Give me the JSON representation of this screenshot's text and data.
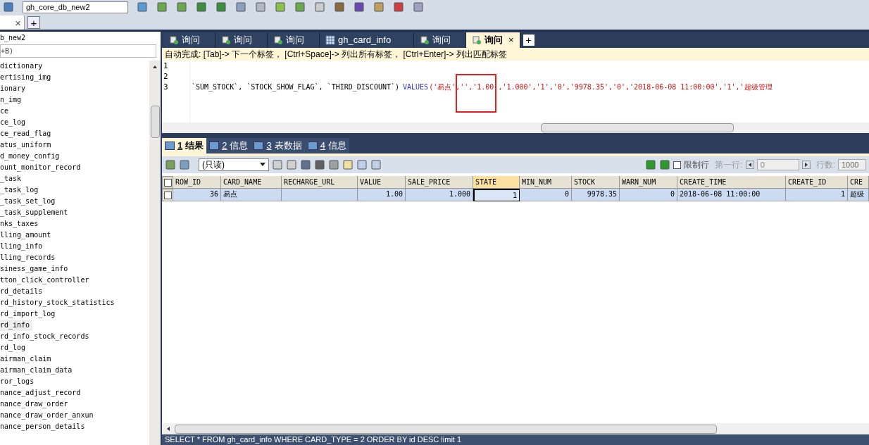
{
  "toolbar": {
    "database_select": "gh_core_db_new2"
  },
  "connection_tabs": {
    "close": "×",
    "add": "+"
  },
  "object_browser": {
    "database": "b_new2",
    "filter": "+B)",
    "tables": [
      {
        "name": "dictionary",
        "selected": false
      },
      {
        "name": "ertising_img",
        "selected": false
      },
      {
        "name": "ionary",
        "selected": false
      },
      {
        "name": "n_img",
        "selected": false
      },
      {
        "name": "ce",
        "selected": false
      },
      {
        "name": "ce_log",
        "selected": false
      },
      {
        "name": "ce_read_flag",
        "selected": false
      },
      {
        "name": "atus_uniform",
        "selected": false
      },
      {
        "name": "d_money_config",
        "selected": false
      },
      {
        "name": "ount_monitor_record",
        "selected": false
      },
      {
        "name": "_task",
        "selected": false
      },
      {
        "name": "_task_log",
        "selected": false
      },
      {
        "name": "_task_set_log",
        "selected": false
      },
      {
        "name": "_task_supplement",
        "selected": false
      },
      {
        "name": "nks_taxes",
        "selected": false
      },
      {
        "name": "lling_amount",
        "selected": false
      },
      {
        "name": "lling_info",
        "selected": false
      },
      {
        "name": "lling_records",
        "selected": false
      },
      {
        "name": "siness_game_info",
        "selected": false
      },
      {
        "name": "tton_click_controller",
        "selected": false
      },
      {
        "name": "rd_details",
        "selected": false
      },
      {
        "name": "rd_history_stock_statistics",
        "selected": false
      },
      {
        "name": "rd_import_log",
        "selected": false
      },
      {
        "name": "rd_info",
        "selected": true
      },
      {
        "name": "rd_info_stock_records",
        "selected": false
      },
      {
        "name": "rd_log",
        "selected": false
      },
      {
        "name": "airman_claim",
        "selected": false
      },
      {
        "name": "airman_claim_data",
        "selected": false
      },
      {
        "name": "ror_logs",
        "selected": false
      },
      {
        "name": "nance_adjust_record",
        "selected": false
      },
      {
        "name": "nance_draw_order",
        "selected": false
      },
      {
        "name": "nance_draw_order_anxun",
        "selected": false
      },
      {
        "name": "nance_person_details",
        "selected": false
      }
    ]
  },
  "query_tabs": [
    {
      "label": "询问",
      "kind": "query",
      "selected": false
    },
    {
      "label": "询问",
      "kind": "query",
      "selected": false
    },
    {
      "label": "询问",
      "kind": "query",
      "selected": false
    },
    {
      "label": "gh_card_info",
      "kind": "table",
      "selected": false
    },
    {
      "label": "询问",
      "kind": "query",
      "selected": false
    },
    {
      "label": "询问",
      "kind": "query",
      "selected": true
    }
  ],
  "query_tab_close": "×",
  "query_tab_add": "+",
  "autocomplete_hint": "自动完成: [Tab]-> 下一个标签， [Ctrl+Space]-> 列出所有标签， [Ctrl+Enter]-> 列出匹配标签",
  "editor": {
    "lines": [
      {
        "number": "1"
      },
      {
        "number": "2"
      },
      {
        "number": "3",
        "code": "`SUM_STOCK`, `STOCK_SHOW_FLAG`, `THIRD_DISCOUNT`)",
        "keyword": "VALUES",
        "values": "('易点','','1.00','1.000','1','0','9978.35','0','2018-06-08 11:00:00','1','超级管理"
      }
    ]
  },
  "result_tabs": [
    {
      "number": "1",
      "label": "结果",
      "selected": true
    },
    {
      "number": "2",
      "label": "信息",
      "selected": false
    },
    {
      "number": "3",
      "label": "表数据",
      "selected": false
    },
    {
      "number": "4",
      "label": "信息",
      "selected": false
    }
  ],
  "result_toolbar": {
    "mode": "(只读)",
    "limit_rows": {
      "label": "限制行",
      "checked": false
    },
    "first_row_label": "第一行:",
    "first_row": "0",
    "rows_label": "行数:",
    "rows": "1000"
  },
  "table": {
    "all_checked": false,
    "columns": [
      {
        "label": "ROW_ID",
        "selected": false
      },
      {
        "label": "CARD_NAME",
        "selected": false
      },
      {
        "label": "RECHARGE_URL",
        "selected": false
      },
      {
        "label": "VALUE",
        "selected": false
      },
      {
        "label": "SALE_PRICE",
        "selected": false
      },
      {
        "label": "STATE",
        "selected": true
      },
      {
        "label": "MIN_NUM",
        "selected": false
      },
      {
        "label": "STOCK",
        "selected": false
      },
      {
        "label": "WARN_NUM",
        "selected": false
      },
      {
        "label": "CREATE_TIME",
        "selected": false
      },
      {
        "label": "CREATE_ID",
        "selected": false
      },
      {
        "label": "CRE",
        "selected": false
      }
    ],
    "rows": [
      {
        "selected": true,
        "checked": false,
        "cells": [
          "36",
          "易点",
          "",
          "1.00",
          "1.000",
          "1",
          "0",
          "9978.35",
          "0",
          "2018-06-08 11:00:00",
          "1",
          "超级"
        ]
      }
    ]
  },
  "status_bar": "SELECT * FROM gh_card_info WHERE CARD_TYPE = 2 ORDER BY id DESC limit 1"
}
